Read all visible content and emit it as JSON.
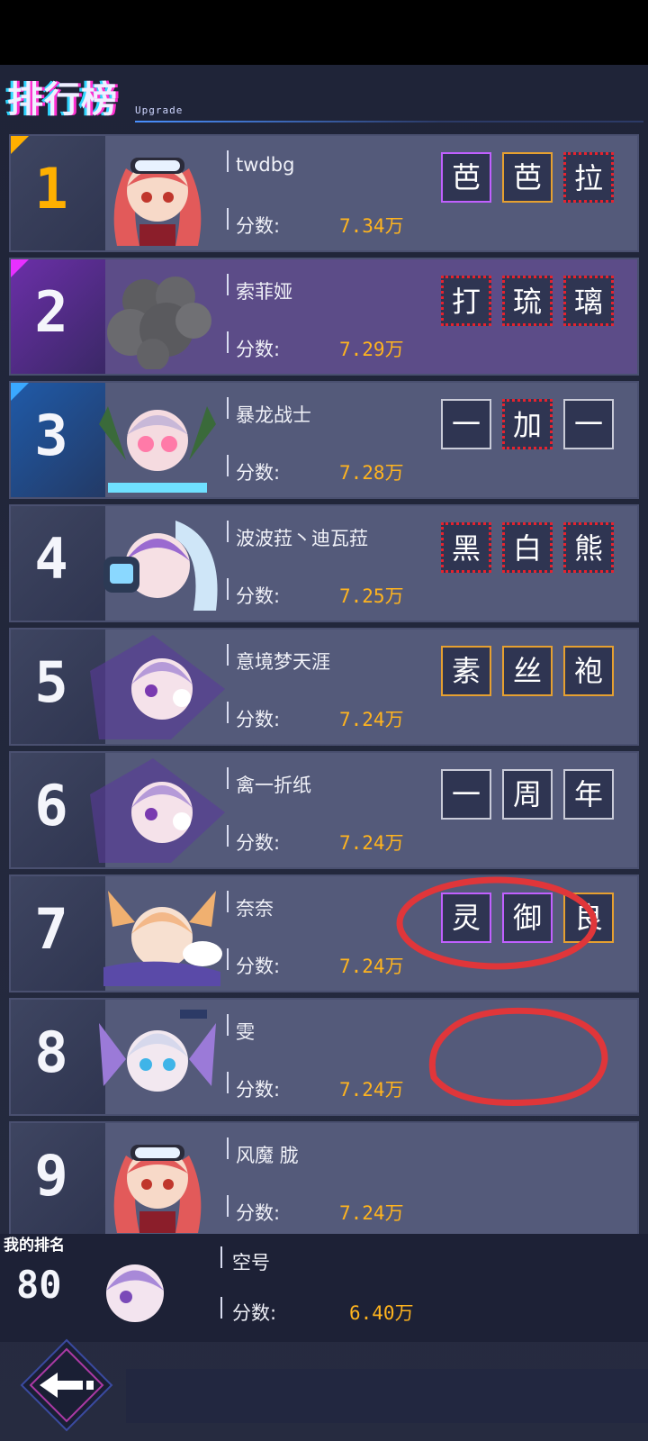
{
  "header": {
    "title": "排行榜",
    "subtitle": "Upgrade"
  },
  "score_label": "分数:",
  "rows": [
    {
      "rank": "1",
      "name": "twdbg",
      "score": "7.34万",
      "badges": [
        "芭",
        "芭",
        "拉"
      ]
    },
    {
      "rank": "2",
      "name": "索菲娅",
      "score": "7.29万",
      "badges": [
        "打",
        "琉",
        "璃"
      ]
    },
    {
      "rank": "3",
      "name": "暴龙战士",
      "score": "7.28万",
      "badges": [
        "一",
        "加",
        "一"
      ]
    },
    {
      "rank": "4",
      "name": "波波菈丶迪瓦菈",
      "score": "7.25万",
      "badges": [
        "黑",
        "白",
        "熊"
      ]
    },
    {
      "rank": "5",
      "name": "意境梦天涯",
      "score": "7.24万",
      "badges": [
        "素",
        "丝",
        "袍"
      ]
    },
    {
      "rank": "6",
      "name": "禽一折纸",
      "score": "7.24万",
      "badges": [
        "一",
        "周",
        "年"
      ]
    },
    {
      "rank": "7",
      "name": "奈奈",
      "score": "7.24万",
      "badges": [
        "灵",
        "御",
        "良"
      ]
    },
    {
      "rank": "8",
      "name": "雯",
      "score": "7.24万",
      "badges": []
    },
    {
      "rank": "9",
      "name": "风魔 胧",
      "score": "7.24万",
      "badges": []
    }
  ],
  "my_rank": {
    "label": "我的排名",
    "rank": "80",
    "name": "空号",
    "score": "6.40万"
  },
  "colors": {
    "score": "#ffb41e",
    "row_bg": "#545a7a",
    "app_bg": "#262b40",
    "badge_red": "#e6222e"
  },
  "icons": {
    "back": "back-arrow-icon"
  }
}
